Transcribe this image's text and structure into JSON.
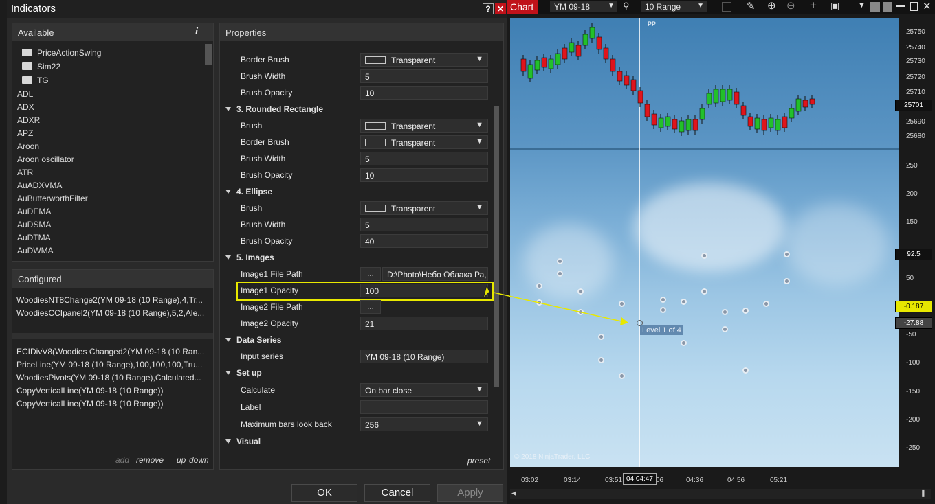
{
  "dialog": {
    "title": "Indicators",
    "help_btn": "?",
    "close_btn": "✕",
    "available": {
      "header": "Available",
      "info": "i",
      "folders": [
        "PriceActionSwing",
        "Sim22",
        "TG"
      ],
      "items": [
        "ADL",
        "ADX",
        "ADXR",
        "APZ",
        "Aroon",
        "Aroon oscillator",
        "ATR",
        "AuADXVMA",
        "AuButterworthFilter",
        "AuDEMA",
        "AuDSMA",
        "AuDTMA",
        "AuDWMA"
      ]
    },
    "configured": {
      "header": "Configured",
      "group1": [
        "WoodiesNT8Change2(YM 09-18 (10 Range),4,Tr...",
        "WoodiesCCIpanel2(YM 09-18 (10 Range),5,2,Ale..."
      ],
      "group2": [
        "ECIDivV8(Woodies Changed2(YM 09-18 (10 Ran...",
        "PriceLine(YM 09-18 (10 Range),100,100,100,Tru...",
        "WoodiesPivots(YM 09-18 (10 Range),Calculated...",
        "CopyVerticalLine(YM 09-18 (10 Range))",
        "CopyVerticalLine(YM 09-18 (10 Range))"
      ],
      "links": {
        "add": "add",
        "remove": "remove",
        "up": "up",
        "down": "down"
      }
    },
    "properties": {
      "header": "Properties",
      "preset": "preset",
      "rows": {
        "r1": {
          "label": "Border Brush",
          "value": "Transparent"
        },
        "r2": {
          "label": "Brush Width",
          "value": "5"
        },
        "r3": {
          "label": "Brush Opacity",
          "value": "10"
        },
        "cat_rr": "3. Rounded Rectangle",
        "r4": {
          "label": "Brush",
          "value": "Transparent"
        },
        "r5": {
          "label": "Border Brush",
          "value": "Transparent"
        },
        "r6": {
          "label": "Brush Width",
          "value": "5"
        },
        "r7": {
          "label": "Brush Opacity",
          "value": "10"
        },
        "cat_el": "4. Ellipse",
        "r8": {
          "label": "Brush",
          "value": "Transparent"
        },
        "r9": {
          "label": "Brush Width",
          "value": "5"
        },
        "r10": {
          "label": "Brush Opacity",
          "value": "40"
        },
        "cat_img": "5. Images",
        "r11": {
          "label": "Image1 File Path",
          "btn": "...",
          "value": "D:\\Photo\\Небо Облака Ра,"
        },
        "r12": {
          "label": "Image1 Opacity",
          "value": "100"
        },
        "r13": {
          "label": "Image2 File Path",
          "btn": "..."
        },
        "r14": {
          "label": "Image2 Opacity",
          "value": "21"
        },
        "cat_ds": "Data Series",
        "r15": {
          "label": "Input series",
          "value": "YM 09-18 (10 Range)"
        },
        "cat_su": "Set up",
        "r16": {
          "label": "Calculate",
          "value": "On bar close"
        },
        "r17": {
          "label": "Label",
          "value": ""
        },
        "r18": {
          "label": "Maximum bars look back",
          "value": "256"
        },
        "cat_vis": "Visual"
      }
    },
    "buttons": {
      "ok": "OK",
      "cancel": "Cancel",
      "apply": "Apply"
    }
  },
  "chart": {
    "tab": "Chart",
    "instrument": "YM 09-18",
    "period": "10 Range",
    "pp_label": "PP",
    "copyright": "© 2018 NinjaTrader, LLC",
    "level_label": "Level 1 of 4",
    "upper_ticks": [
      "25750",
      "25740",
      "25730",
      "25720",
      "25710",
      "25690",
      "25680"
    ],
    "lower_ticks": [
      "250",
      "200",
      "150",
      "50",
      "-50",
      "-100",
      "-150",
      "-200",
      "-250"
    ],
    "price_labels": {
      "last": "25701",
      "cci": "92.5",
      "ind2": "-0.187",
      "crosshair": "-27.88"
    },
    "time_ticks": [
      "03:02",
      "03:14",
      "03:51",
      "06",
      "04:36",
      "04:56",
      "05:21"
    ],
    "time_crosshair": "04:04:47",
    "colors": {
      "up": "#22c02a",
      "down": "#e0141c",
      "highlight": "#e8e800"
    }
  }
}
